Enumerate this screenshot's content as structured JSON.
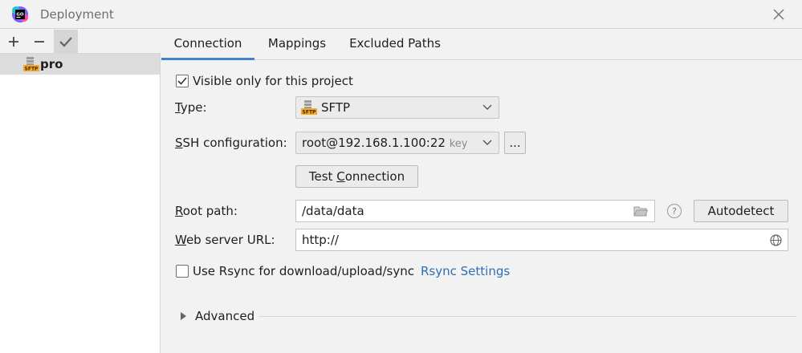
{
  "window": {
    "title": "Deployment"
  },
  "toolbar": {
    "add": "+",
    "remove": "−"
  },
  "servers": [
    {
      "name": "pro",
      "type_icon": "SFTP"
    }
  ],
  "tabs": [
    {
      "label": "Connection",
      "active": true
    },
    {
      "label": "Mappings",
      "active": false
    },
    {
      "label": "Excluded Paths",
      "active": false
    }
  ],
  "connection": {
    "visible_only": {
      "label": "Visible only for this project",
      "checked": true
    },
    "type": {
      "label_mn": "T",
      "label_rest": "ype:",
      "value": "SFTP"
    },
    "ssh": {
      "label_mn": "S",
      "label_rest": "SH configuration:",
      "value": "root@192.168.1.100:22",
      "hint": "key",
      "browse": "..."
    },
    "test": {
      "pre": "Test ",
      "mn": "C",
      "post": "onnection"
    },
    "root_path": {
      "label_mn": "R",
      "label_rest": "oot path:",
      "value": "/data/data",
      "help": "?",
      "autodetect": "Autodetect"
    },
    "web_url": {
      "label_mn": "W",
      "label_rest": "eb server URL:",
      "value": "http://"
    },
    "rsync": {
      "label": "Use Rsync for download/upload/sync",
      "checked": false,
      "settings_link": "Rsync Settings"
    },
    "advanced": {
      "label": "Advanced"
    }
  },
  "colors": {
    "accent": "#4083c9",
    "link": "#2d6fb7",
    "selection": "#dcdcdc"
  }
}
